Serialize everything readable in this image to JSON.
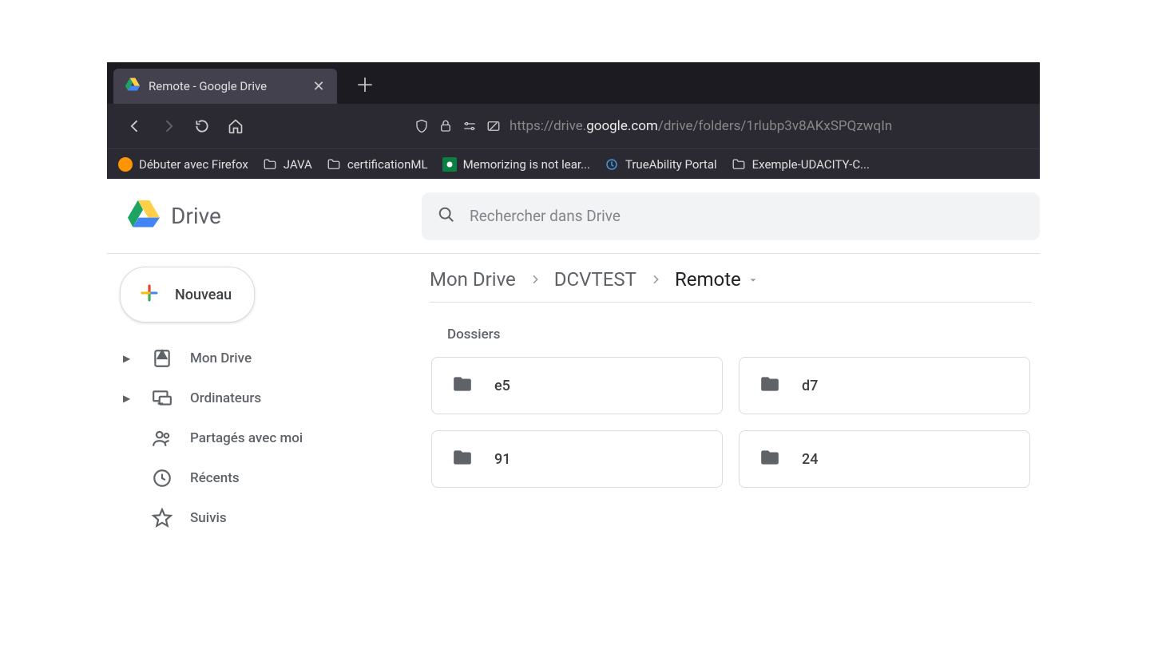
{
  "browser": {
    "tab": {
      "title": "Remote - Google Drive"
    },
    "url": {
      "protocol": "https://",
      "host_pre": "drive.",
      "host_main": "google.com",
      "path": "/drive/folders/1rlubp3v8AKxSPQzwqIn"
    },
    "bookmarks": [
      {
        "label": "Débuter avec Firefox",
        "icon": "firefox"
      },
      {
        "label": "JAVA",
        "icon": "folder"
      },
      {
        "label": "certificationML",
        "icon": "folder"
      },
      {
        "label": "Memorizing is not lear...",
        "icon": "green"
      },
      {
        "label": "TrueAbility Portal",
        "icon": "blue"
      },
      {
        "label": "Exemple-UDACITY-C...",
        "icon": "folder"
      }
    ]
  },
  "drive": {
    "logo_text": "Drive",
    "search_placeholder": "Rechercher dans Drive",
    "new_button": "Nouveau",
    "nav": [
      {
        "label": "Mon Drive",
        "icon": "mydrive",
        "expandable": true
      },
      {
        "label": "Ordinateurs",
        "icon": "computers",
        "expandable": true
      },
      {
        "label": "Partagés avec moi",
        "icon": "shared",
        "expandable": false
      },
      {
        "label": "Récents",
        "icon": "recent",
        "expandable": false
      },
      {
        "label": "Suivis",
        "icon": "starred",
        "expandable": false
      }
    ],
    "breadcrumb": [
      "Mon Drive",
      "DCVTEST",
      "Remote"
    ],
    "section_label": "Dossiers",
    "folders": [
      {
        "name": "e5"
      },
      {
        "name": "d7"
      },
      {
        "name": "91"
      },
      {
        "name": "24"
      }
    ]
  }
}
